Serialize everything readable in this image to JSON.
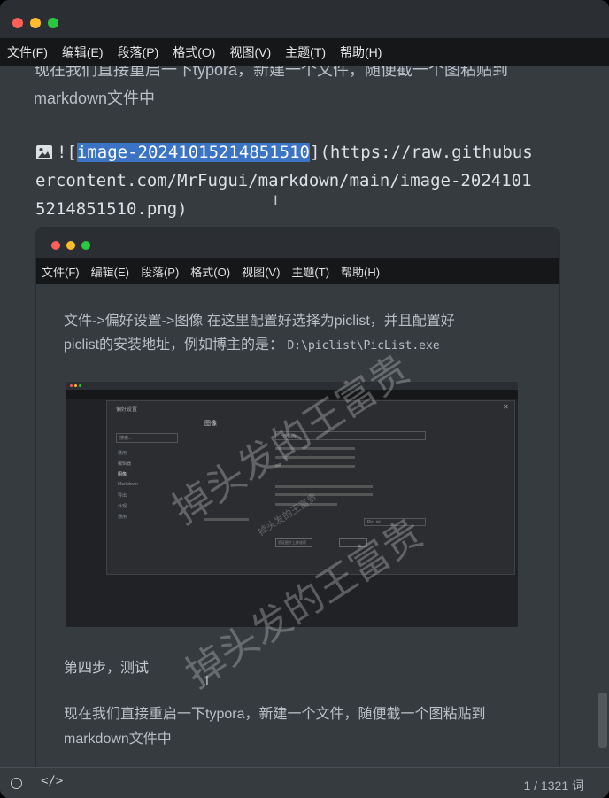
{
  "menu": [
    "文件(F)",
    "编辑(E)",
    "段落(P)",
    "格式(O)",
    "视图(V)",
    "主题(T)",
    "帮助(H)"
  ],
  "paragraph_top": {
    "line1": "现在我们直接重启一下typora，新建一个文件，随便截一个图粘贴到",
    "line2": "markdown文件中"
  },
  "markdown_image": {
    "prefix": "![",
    "selected": "image-20241015214851510",
    "line1_rest": "](https://raw.githubus",
    "line2": "ercontent.com/MrFugui/markdown/main/image-2024101",
    "line3": "5214851510.png)"
  },
  "embedded": {
    "menu": [
      "文件(F)",
      "编辑(E)",
      "段落(P)",
      "格式(O)",
      "视图(V)",
      "主题(T)",
      "帮助(H)"
    ],
    "line1": "文件->偏好设置->图像   在这里配置好选择为piclist，并且配置好",
    "line2_text": "piclist的安装地址，例如博主的是：",
    "line2_code": "D:\\piclist\\PicList.exe",
    "step": "第四步，测试",
    "para1": "现在我们直接重启一下typora，新建一个文件，随便截一个图粘贴到",
    "para2": "markdown文件中"
  },
  "nested_dialog": {
    "title": "偏好设置",
    "search": "搜索...",
    "sidebar": [
      "通用",
      "编辑器",
      "图像",
      "Markdown",
      "导出",
      "外观",
      "通用"
    ],
    "heading": "图像",
    "option1": "上传图片",
    "option2": "PicList",
    "button": "验证图片上传选项"
  },
  "watermark": "掉头发的王富贵",
  "status": {
    "word_count": "1 / 1321 词"
  },
  "colors": {
    "bg": "#363b40",
    "menubar": "#161719",
    "titlebar": "#2b2e32",
    "selection": "#3b74c4",
    "close": "#fe5f57",
    "minimize": "#febc2e",
    "zoom": "#28c840"
  }
}
